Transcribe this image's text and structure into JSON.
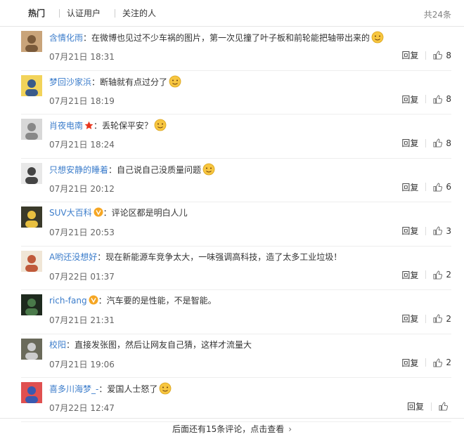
{
  "tabs": [
    {
      "label": "热门"
    },
    {
      "label": "认证用户"
    },
    {
      "label": "关注的人"
    }
  ],
  "total": "共24条",
  "comments": [
    {
      "user": "含情化雨",
      "text": "在微博也见过不少车祸的图片，第一次见撞了叶子板和前轮能把轴带出来的",
      "time": "07月21日 18:31",
      "likes": "8",
      "reply": "回复",
      "emoji": "sleepy-emoji"
    },
    {
      "user": "梦回沙家浜",
      "text": "断轴就有点过分了",
      "time": "07月21日 18:19",
      "likes": "8",
      "reply": "回复",
      "emoji": "laugh-cry-emoji"
    },
    {
      "user": "肖夜电南",
      "text": "丢轮保平安？",
      "time": "07月21日 18:24",
      "likes": "8",
      "reply": "回复",
      "emoji": "doge-emoji",
      "badge": "star"
    },
    {
      "user": "只想安静的睡着",
      "text": "自己说自己没质量问题",
      "time": "07月21日 20:12",
      "likes": "6",
      "reply": "回复",
      "emoji": "laugh-cry-emoji"
    },
    {
      "user": "SUV大百科",
      "text": "评论区都是明白人儿",
      "time": "07月21日 20:53",
      "likes": "3",
      "reply": "回复",
      "badge": "v"
    },
    {
      "user": "A哟还没想好",
      "text": "现在新能源车竞争太大，一味强调高科技，造了太多工业垃圾！",
      "time": "07月22日 01:37",
      "likes": "2",
      "reply": "回复"
    },
    {
      "user": "rich-fang",
      "text": "汽车要的是性能，不是智能。",
      "time": "07月21日 21:31",
      "likes": "2",
      "reply": "回复",
      "badge": "v"
    },
    {
      "user": "校阳",
      "text": "直接发张图，然后让网友自己猜，这样才流量大",
      "time": "07月21日 19:06",
      "likes": "2",
      "reply": "回复"
    },
    {
      "user": "喜多川海梦_-",
      "text": "爱国人士怒了",
      "time": "07月22日 12:47",
      "likes": "",
      "reply": "回复",
      "emoji": "smile-emoji"
    }
  ],
  "more": "后面还有15条评论，点击查看",
  "colors": {
    "link": "#3c7dcb",
    "badge_gold": "#f5a623",
    "badge_red": "#e8351d"
  }
}
